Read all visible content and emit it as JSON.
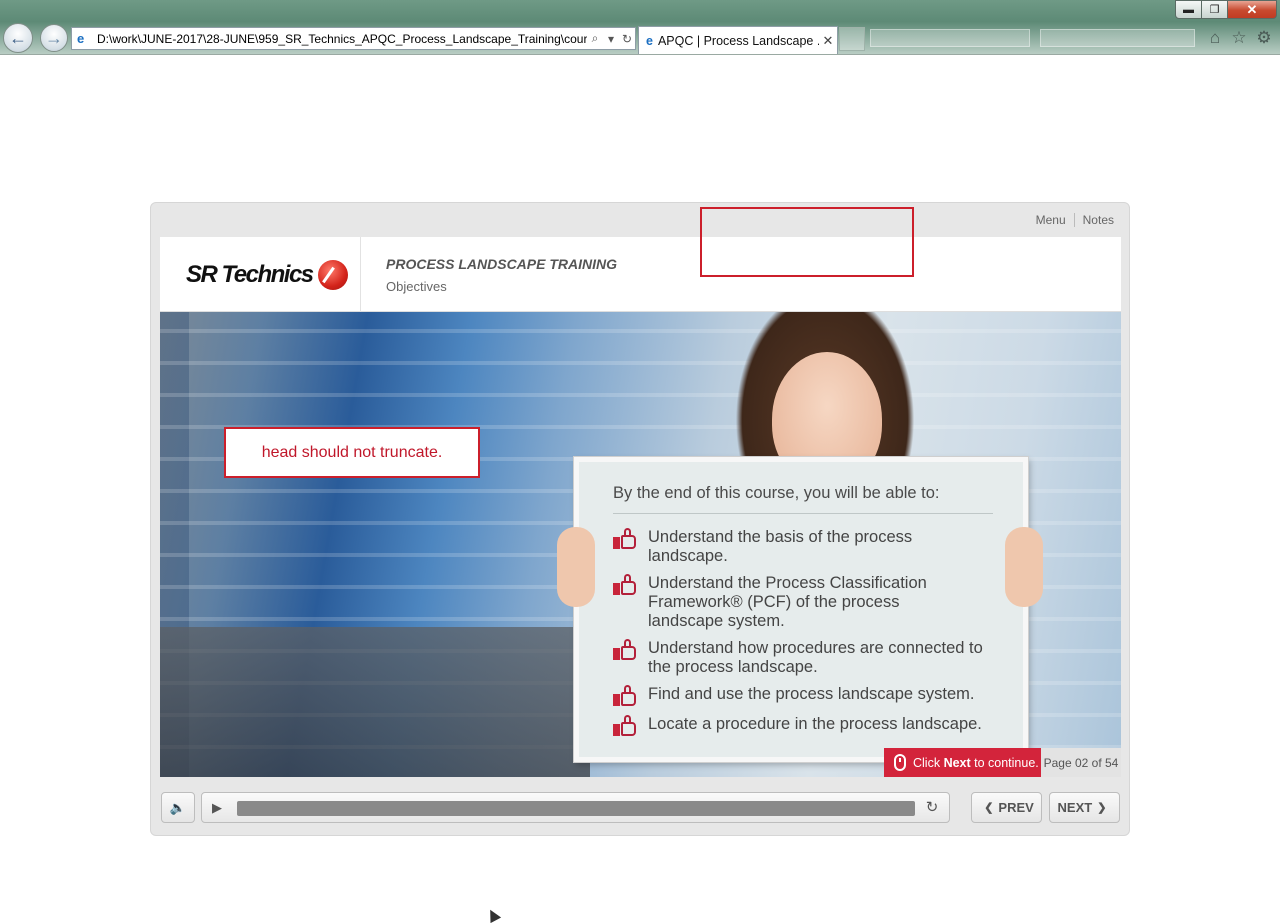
{
  "browser": {
    "address": "D:\\work\\JUNE-2017\\28-JUNE\\959_SR_Technics_APQC_Process_Landscape_Training\\course\\",
    "tab_title": "APQC | Process Landscape ...",
    "tab_close": "✕",
    "back_glyph": "←",
    "forward_glyph": "→",
    "icons": [
      "ie-icon",
      "search-icon",
      "dropdown-icon",
      "refresh-icon",
      "home-icon",
      "star-icon",
      "gear-icon"
    ],
    "window_controls": {
      "minimize": "▬",
      "maximize": "❐",
      "close": "✕"
    }
  },
  "course": {
    "top_links": {
      "menu": "Menu",
      "notes": "Notes"
    },
    "logo": "SR Technics",
    "title": "PROCESS LANDSCAPE TRAINING",
    "subtitle": "Objectives",
    "board": {
      "heading": "By the end of this course, you will be able to:",
      "objectives": [
        "Understand the basis of the process landscape.",
        "Understand the Process Classification\nFramework® (PCF) of the process\nlandscape system.",
        "Understand how procedures are connected to\nthe process landscape.",
        "Find and use the process landscape system.",
        "Locate a procedure in the process landscape."
      ]
    },
    "continue_prompt": {
      "before": "Click ",
      "bold": "Next",
      "after": " to continue."
    },
    "page_indicator": "Page 02 of 54",
    "controls": {
      "prev_label": "PREV",
      "next_label": "NEXT",
      "progress": 0.0
    }
  },
  "annotations": {
    "truncate_note": "head should not truncate."
  },
  "colors": {
    "accent_red": "#d3243b",
    "annotation_red": "#cc1f2b"
  }
}
